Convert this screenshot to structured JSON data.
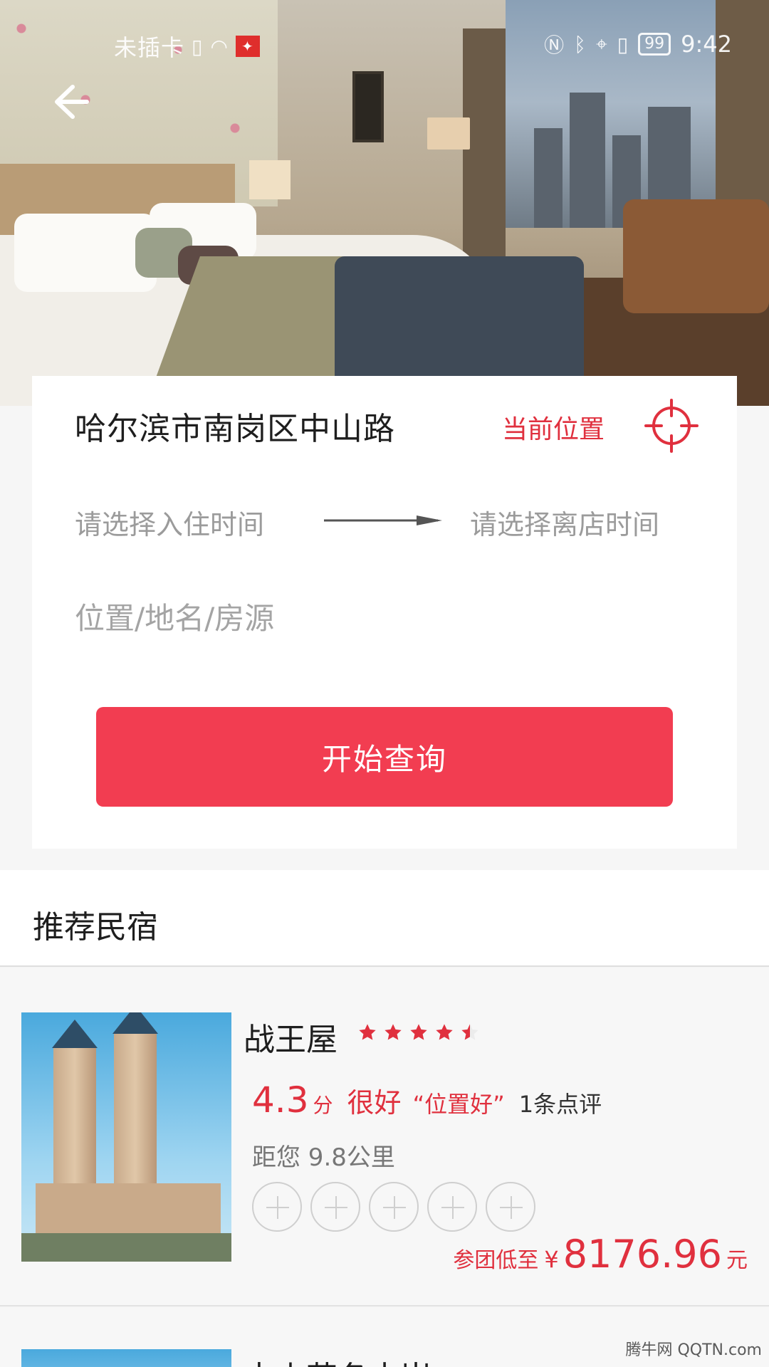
{
  "status_bar": {
    "carrier": "未插卡",
    "time": "9:42",
    "battery": "99",
    "icons": [
      "sim-icon",
      "wifi-icon",
      "app-flag-icon",
      "nfc-icon",
      "bluetooth-icon",
      "location-icon",
      "vibrate-icon",
      "battery-icon"
    ]
  },
  "header": {
    "back_icon": "arrow-left-icon"
  },
  "search": {
    "address": "哈尔滨市南岗区中山路",
    "current_location_label": "当前位置",
    "checkin_placeholder": "请选择入住时间",
    "checkout_placeholder": "请选择离店时间",
    "place_placeholder": "位置/地名/房源",
    "search_button": "开始查询"
  },
  "recommend": {
    "title": "推荐民宿",
    "items": [
      {
        "name": "战王屋",
        "stars": 4.5,
        "score": "4.3",
        "score_unit": "分",
        "praise": "很好",
        "quote": "“位置好”",
        "reviews": "1条点评",
        "distance": "距您 9.8公里",
        "price_label": "参团低至",
        "currency": "¥",
        "price": "8176.96",
        "price_unit": "元"
      },
      {
        "name": "中山花冬水岸"
      }
    ]
  },
  "watermark": "腾牛网 QQTN.com",
  "colors": {
    "accent": "#f23d51",
    "accent_text": "#e0303e",
    "muted": "#9b9b9b"
  }
}
